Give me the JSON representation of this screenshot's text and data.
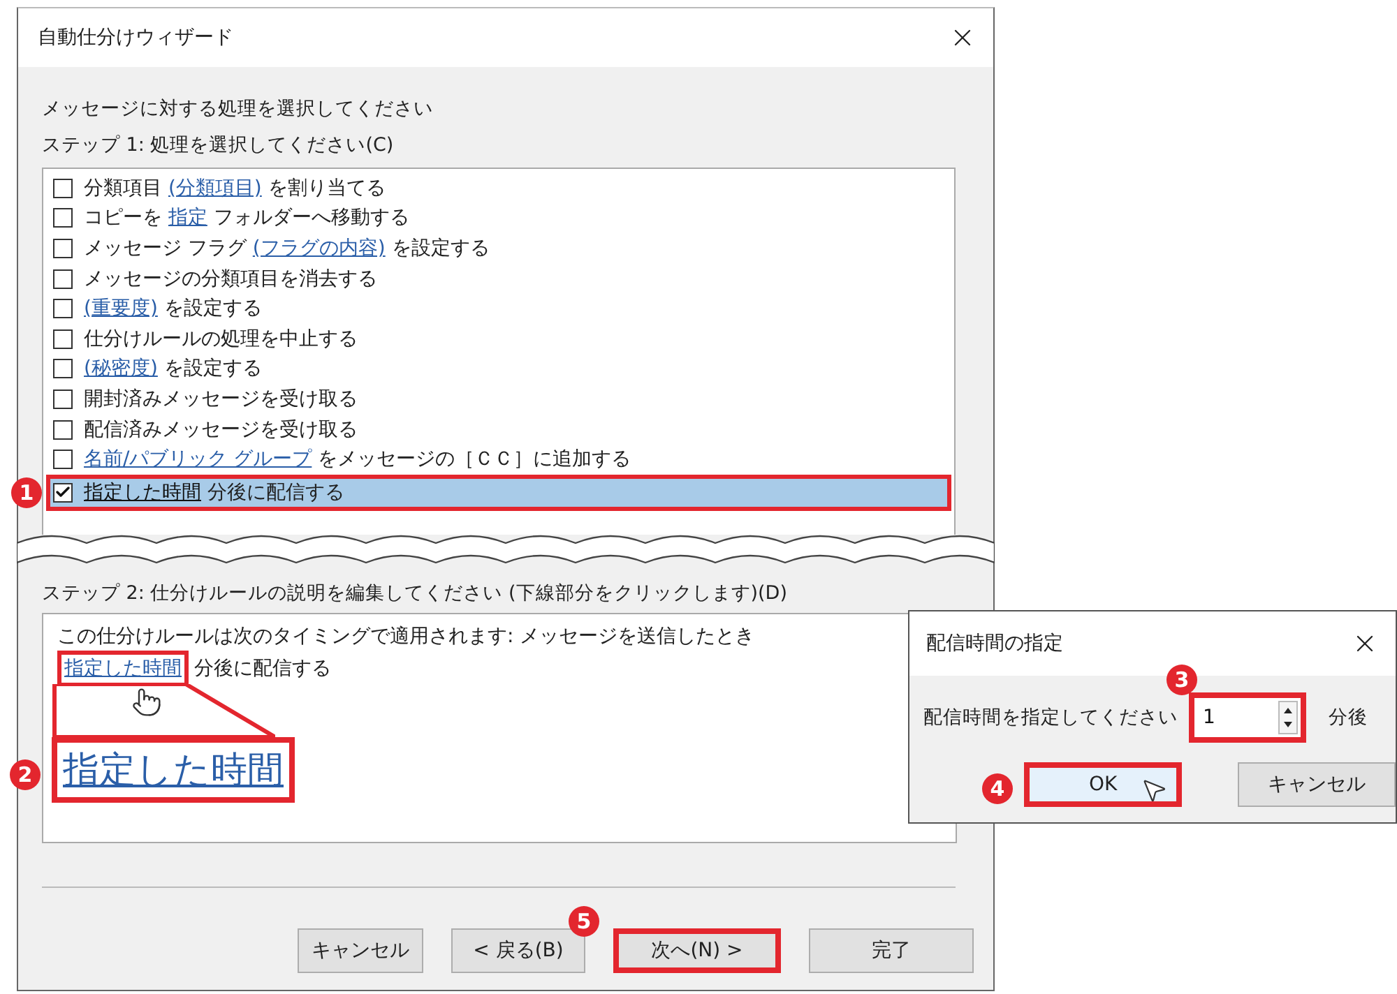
{
  "window": {
    "title": "自動仕分けウィザード"
  },
  "prompt": "メッセージに対する処理を選択してください",
  "step1": {
    "label": "ステップ 1: 処理を選択してください(C)",
    "actions": [
      {
        "checked": false,
        "selected": false,
        "parts": [
          {
            "text": "分類項目 ",
            "link": false
          },
          {
            "text": "(分類項目)",
            "link": true
          },
          {
            "text": " を割り当てる",
            "link": false
          }
        ]
      },
      {
        "checked": false,
        "selected": false,
        "parts": [
          {
            "text": "コピーを ",
            "link": false
          },
          {
            "text": "指定",
            "link": true
          },
          {
            "text": " フォルダーへ移動する",
            "link": false
          }
        ]
      },
      {
        "checked": false,
        "selected": false,
        "parts": [
          {
            "text": "メッセージ フラグ ",
            "link": false
          },
          {
            "text": "(フラグの内容)",
            "link": true
          },
          {
            "text": " を設定する",
            "link": false
          }
        ]
      },
      {
        "checked": false,
        "selected": false,
        "parts": [
          {
            "text": "メッセージの分類項目を消去する",
            "link": false
          }
        ]
      },
      {
        "checked": false,
        "selected": false,
        "parts": [
          {
            "text": "(重要度)",
            "link": true
          },
          {
            "text": " を設定する",
            "link": false
          }
        ]
      },
      {
        "checked": false,
        "selected": false,
        "parts": [
          {
            "text": "仕分けルールの処理を中止する",
            "link": false
          }
        ]
      },
      {
        "checked": false,
        "selected": false,
        "parts": [
          {
            "text": "(秘密度)",
            "link": true
          },
          {
            "text": " を設定する",
            "link": false
          }
        ]
      },
      {
        "checked": false,
        "selected": false,
        "parts": [
          {
            "text": "開封済みメッセージを受け取る",
            "link": false
          }
        ]
      },
      {
        "checked": false,
        "selected": false,
        "parts": [
          {
            "text": "配信済みメッセージを受け取る",
            "link": false
          }
        ]
      },
      {
        "checked": false,
        "selected": false,
        "parts": [
          {
            "text": "名前/パブリック グループ",
            "link": true
          },
          {
            "text": " をメッセージの［ＣＣ］に追加する",
            "link": false
          }
        ]
      },
      {
        "checked": true,
        "selected": true,
        "badge": "1",
        "parts": [
          {
            "text": "指定した時間",
            "link": true
          },
          {
            "text": " 分後に配信する",
            "link": false
          }
        ]
      }
    ]
  },
  "step2": {
    "label": "ステップ 2: 仕分けルールの説明を編集してください (下線部分をクリックします)(D)",
    "line1": "この仕分けルールは次のタイミングで適用されます: メッセージを送信したとき",
    "link": "指定した時間",
    "rest": "分後に配信する",
    "zoom_text": "指定した時間",
    "zoom_badge": "2"
  },
  "buttons": [
    {
      "label": "キャンセル",
      "highlighted": false
    },
    {
      "label": "< 戻る(B)",
      "highlighted": false
    },
    {
      "label": "次へ(N) >",
      "highlighted": true,
      "badge": "5"
    },
    {
      "label": "完了",
      "highlighted": false
    }
  ],
  "popup": {
    "title": "配信時間の指定",
    "prompt": "配信時間を指定してください",
    "value": "1",
    "value_badge": "3",
    "unit": "分後",
    "buttons": [
      {
        "label": "OK",
        "highlighted": true,
        "badge": "4"
      },
      {
        "label": "キャンセル",
        "highlighted": false
      }
    ]
  }
}
